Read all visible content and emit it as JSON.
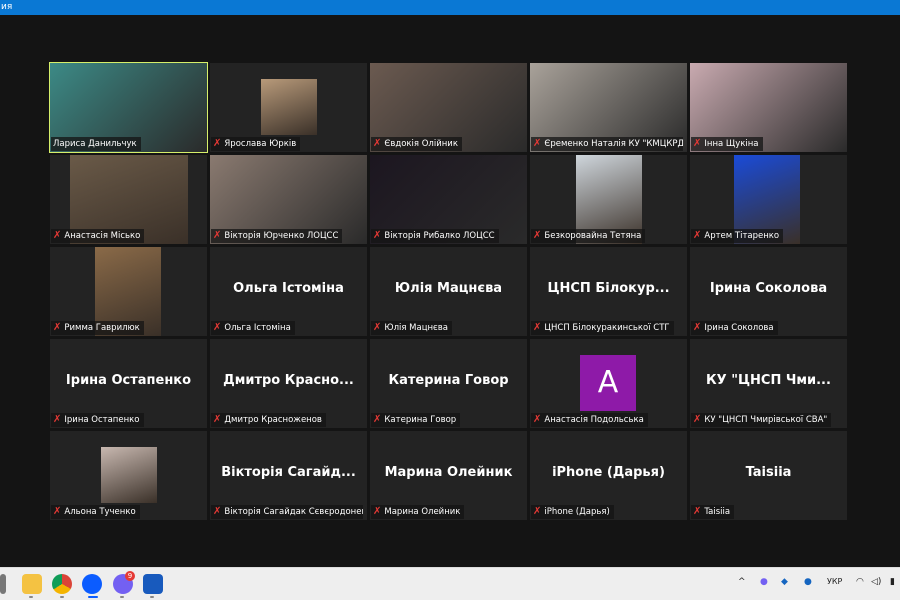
{
  "window_title": "ия",
  "participants": [
    {
      "display": "Лариса Данильчук",
      "kind": "video",
      "active": true
    },
    {
      "display": "Ярослава Юрків",
      "kind": "photo"
    },
    {
      "display": "Євдокія Олійник",
      "kind": "video"
    },
    {
      "display": "Єременко Наталія КУ \"КМЦКРДО...",
      "kind": "video"
    },
    {
      "display": "Інна Щукіна",
      "kind": "video"
    },
    {
      "display": "Анастасія Місько",
      "kind": "photo"
    },
    {
      "display": "Вікторія Юрченко ЛОЦСС",
      "kind": "video"
    },
    {
      "display": "Вікторія Рибалко ЛОЦСС",
      "kind": "video"
    },
    {
      "display": "Безкоровайна Тетяна",
      "kind": "photo"
    },
    {
      "display": "Артем Тітаренко",
      "kind": "photo"
    },
    {
      "display": "Римма Гаврилюк",
      "kind": "photo"
    },
    {
      "display": "Ольга Істоміна",
      "kind": "name",
      "big": "Ольга Істоміна"
    },
    {
      "display": "Юлія Мацнєва",
      "kind": "name",
      "big": "Юлія Мацнєва"
    },
    {
      "display": "ЦНСП Білокуракинської СТГ",
      "kind": "name",
      "big": "ЦНСП Білокур..."
    },
    {
      "display": "Ірина Соколова",
      "kind": "name",
      "big": "Ірина Соколова"
    },
    {
      "display": "Ірина Остапенко",
      "kind": "name",
      "big": "Ірина Остапенко"
    },
    {
      "display": "Дмитро Красноженов",
      "kind": "name",
      "big": "Дмитро Красно..."
    },
    {
      "display": "Катерина Говор",
      "kind": "name",
      "big": "Катерина Говор"
    },
    {
      "display": "Анастасія Подольська",
      "kind": "avatar",
      "big": "A",
      "avatar_color": "#8e1aa8"
    },
    {
      "display": "КУ \"ЦНСП Чмирівської СВА\"",
      "kind": "name",
      "big": "КУ \"ЦНСП Чми..."
    },
    {
      "display": "Альона Тученко",
      "kind": "photo"
    },
    {
      "display": "Вікторія Сагайдак Сєвєродонець...",
      "kind": "name",
      "big": "Вікторія Сагайд..."
    },
    {
      "display": "Марина Олейник",
      "kind": "name",
      "big": "Марина Олейник"
    },
    {
      "display": "iPhone (Дарья)",
      "kind": "name",
      "big": "iPhone (Дарья)"
    },
    {
      "display": "Taisiia",
      "kind": "name",
      "big": "Taisiia"
    }
  ],
  "taskbar": {
    "apps": [
      "file-explorer",
      "chrome",
      "zoom",
      "viber",
      "word"
    ],
    "viber_badge": "9",
    "language": "УКР"
  }
}
